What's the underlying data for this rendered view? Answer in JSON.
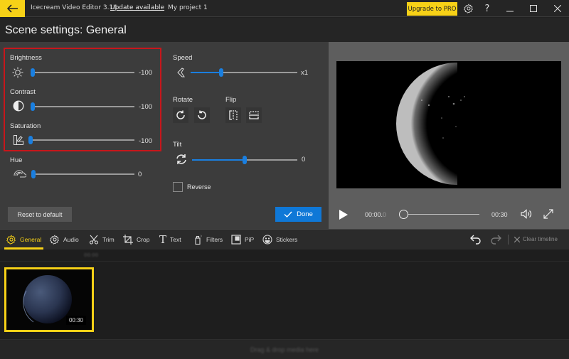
{
  "titlebar": {
    "app_name": "Icecream Video Editor 3.14",
    "update_link": "Update available",
    "project_name": "My project 1",
    "upgrade_label": "Upgrade to PRO",
    "help_label": "?",
    "separator": "·"
  },
  "header": {
    "title": "Scene settings: General"
  },
  "settings": {
    "brightness": {
      "label": "Brightness",
      "value": "-100",
      "fraction": 0.0
    },
    "contrast": {
      "label": "Contrast",
      "value": "-100",
      "fraction": 0.0
    },
    "saturation": {
      "label": "Saturation",
      "value": "-100",
      "fraction": 0.0
    },
    "hue": {
      "label": "Hue",
      "value": "0",
      "fraction": 0.0
    },
    "speed": {
      "label": "Speed",
      "value": "x1",
      "fraction": 0.28
    },
    "rotate": {
      "label": "Rotate"
    },
    "flip": {
      "label": "Flip"
    },
    "tilt": {
      "label": "Tilt",
      "value": "0",
      "fraction": 0.5
    },
    "reverse": {
      "label": "Reverse",
      "checked": false
    },
    "reset_label": "Reset to default",
    "done_label": "Done"
  },
  "player": {
    "current_time": "00:00.",
    "current_time_fraction": "0",
    "duration": "00:30",
    "progress": 0.0
  },
  "tabs": [
    {
      "label": "General",
      "icon": "gear-icon",
      "active": true
    },
    {
      "label": "Audio",
      "icon": "gear-icon",
      "active": false
    },
    {
      "label": "Trim",
      "icon": "scissors-icon",
      "active": false
    },
    {
      "label": "Crop",
      "icon": "crop-icon",
      "active": false
    },
    {
      "label": "Text",
      "icon": "text-icon",
      "active": false
    },
    {
      "label": "Filters",
      "icon": "spray-icon",
      "active": false
    },
    {
      "label": "PiP",
      "icon": "pip-icon",
      "active": false
    },
    {
      "label": "Stickers",
      "icon": "smiley-icon",
      "active": false
    }
  ],
  "toolbar": {
    "clear_timeline": "Clear timeline"
  },
  "timeline": {
    "ruler_label": "00:00",
    "clip": {
      "duration": "00:30"
    },
    "dropzone_text": "Drag & drop media here"
  },
  "colors": {
    "accent_yellow": "#f7d117",
    "accent_blue": "#0f78d7",
    "highlight_red": "#c8161b"
  }
}
